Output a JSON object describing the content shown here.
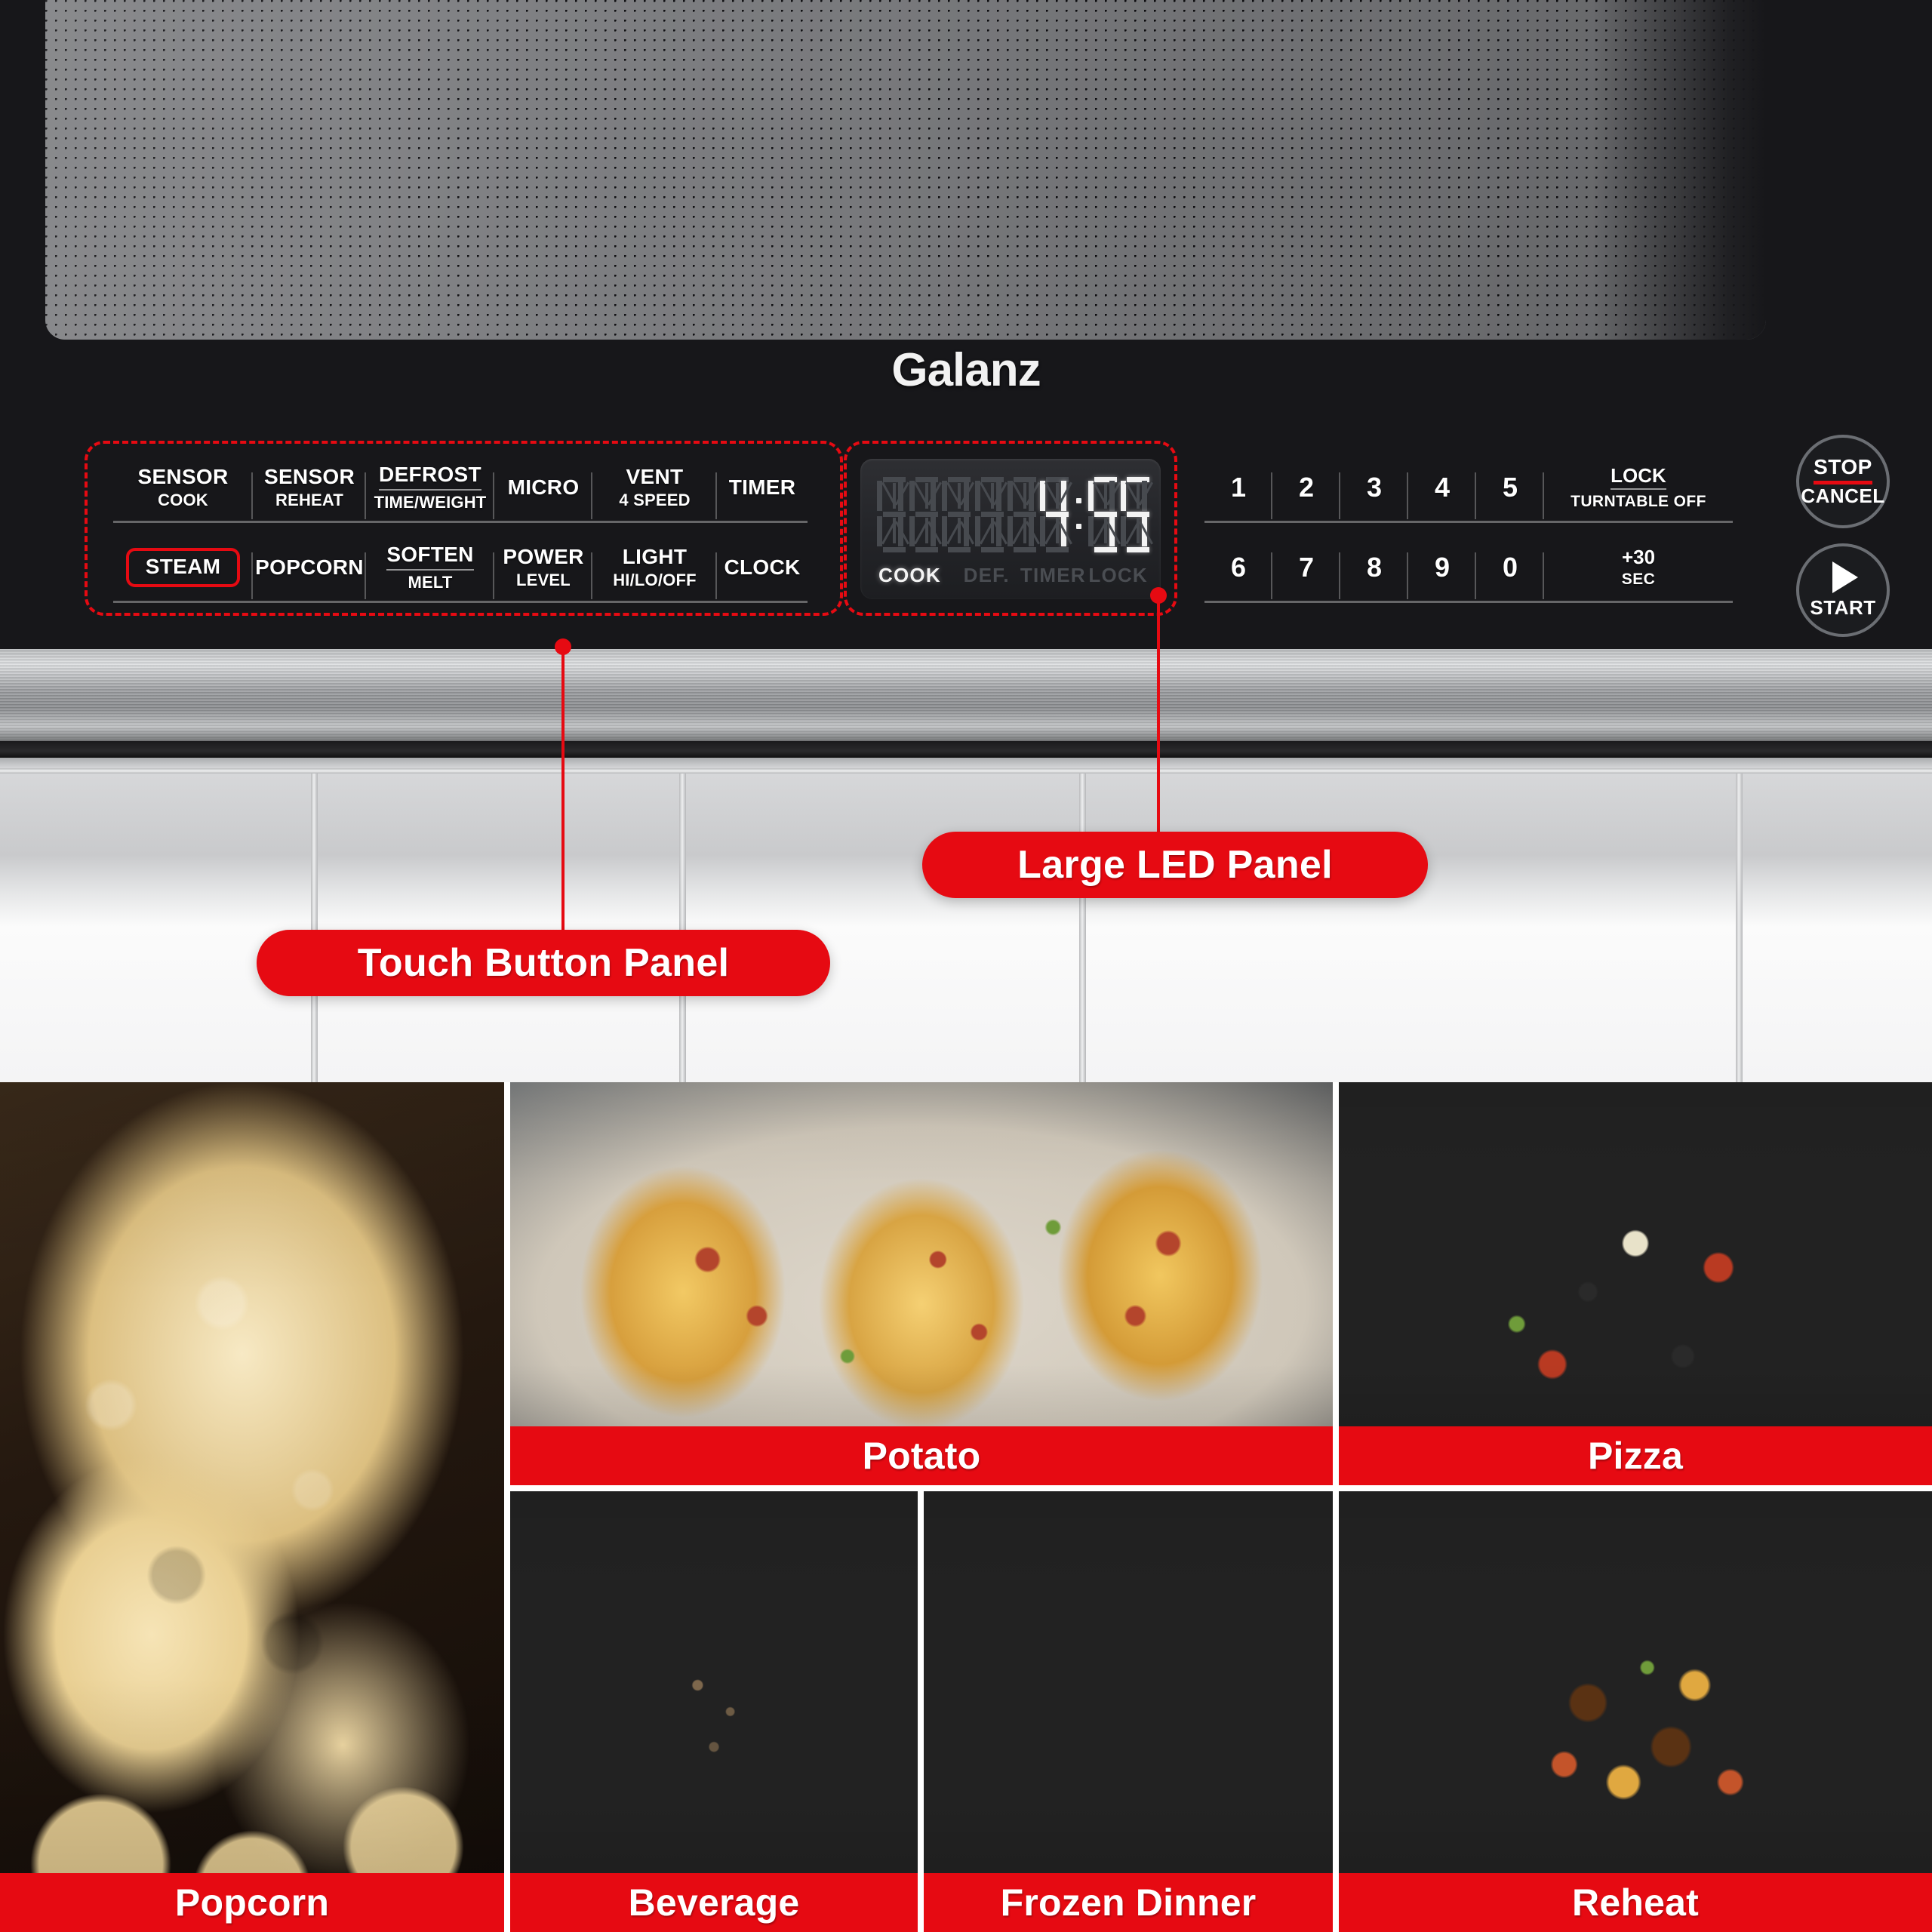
{
  "appliance": {
    "brand": "Galanz",
    "control_panel": {
      "touch_buttons_row1": [
        {
          "line1": "SENSOR",
          "line2": "COOK",
          "style": "plain"
        },
        {
          "line1": "SENSOR",
          "line2": "REHEAT",
          "style": "plain"
        },
        {
          "line1": "DEFROST",
          "line2": "TIME/WEIGHT",
          "style": "split"
        },
        {
          "line1": "MICRO",
          "line2": "",
          "style": "plain"
        },
        {
          "line1": "VENT",
          "line2": "4 SPEED",
          "style": "plain"
        },
        {
          "line1": "TIMER",
          "line2": "",
          "style": "plain"
        }
      ],
      "touch_buttons_row2": [
        {
          "line1": "STEAM",
          "line2": "",
          "style": "highlighted"
        },
        {
          "line1": "POPCORN",
          "line2": "",
          "style": "plain"
        },
        {
          "line1": "SOFTEN",
          "line2": "MELT",
          "style": "split"
        },
        {
          "line1": "POWER",
          "line2": "LEVEL",
          "style": "plain"
        },
        {
          "line1": "LIGHT",
          "line2": "HI/LO/OFF",
          "style": "plain"
        },
        {
          "line1": "CLOCK",
          "line2": "",
          "style": "plain"
        }
      ],
      "keypad_row1": [
        "1",
        "2",
        "3",
        "4",
        "5"
      ],
      "keypad_row2": [
        "6",
        "7",
        "8",
        "9",
        "0"
      ],
      "keypad_extra_row1": {
        "line1": "LOCK",
        "line2": "TURNTABLE OFF"
      },
      "keypad_extra_row2": {
        "line1": "+30",
        "line2": "SEC"
      },
      "stop_button": {
        "line1": "STOP",
        "line2": "CANCEL"
      },
      "start_button": {
        "label": "START",
        "icon": "play-triangle-icon"
      },
      "accent_color": "#e60a12"
    },
    "led_display": {
      "digits": "4:55",
      "digit_slots": 7,
      "lit_digits": [
        "4",
        "5",
        "5"
      ],
      "status_labels": [
        {
          "label": "COOK",
          "lit": true
        },
        {
          "label": "DEF.",
          "lit": false
        },
        {
          "label": "TIMER",
          "lit": false
        },
        {
          "label": "LOCK",
          "lit": false
        }
      ]
    }
  },
  "callouts": [
    {
      "id": "touch-panel",
      "label": "Touch Button Panel"
    },
    {
      "id": "led-panel",
      "label": "Large LED Panel"
    }
  ],
  "food_grid": [
    {
      "id": "popcorn",
      "caption": "Popcorn"
    },
    {
      "id": "potato",
      "caption": "Potato"
    },
    {
      "id": "pizza",
      "caption": "Pizza"
    },
    {
      "id": "beverage",
      "caption": "Beverage"
    },
    {
      "id": "frozen-dinner",
      "caption": "Frozen Dinner"
    },
    {
      "id": "reheat",
      "caption": "Reheat"
    }
  ],
  "colors": {
    "brand_red": "#e60a12",
    "panel_black": "#17171a",
    "led_off_segment": "#474a4f",
    "led_on_segment": "#f3f3f3"
  }
}
